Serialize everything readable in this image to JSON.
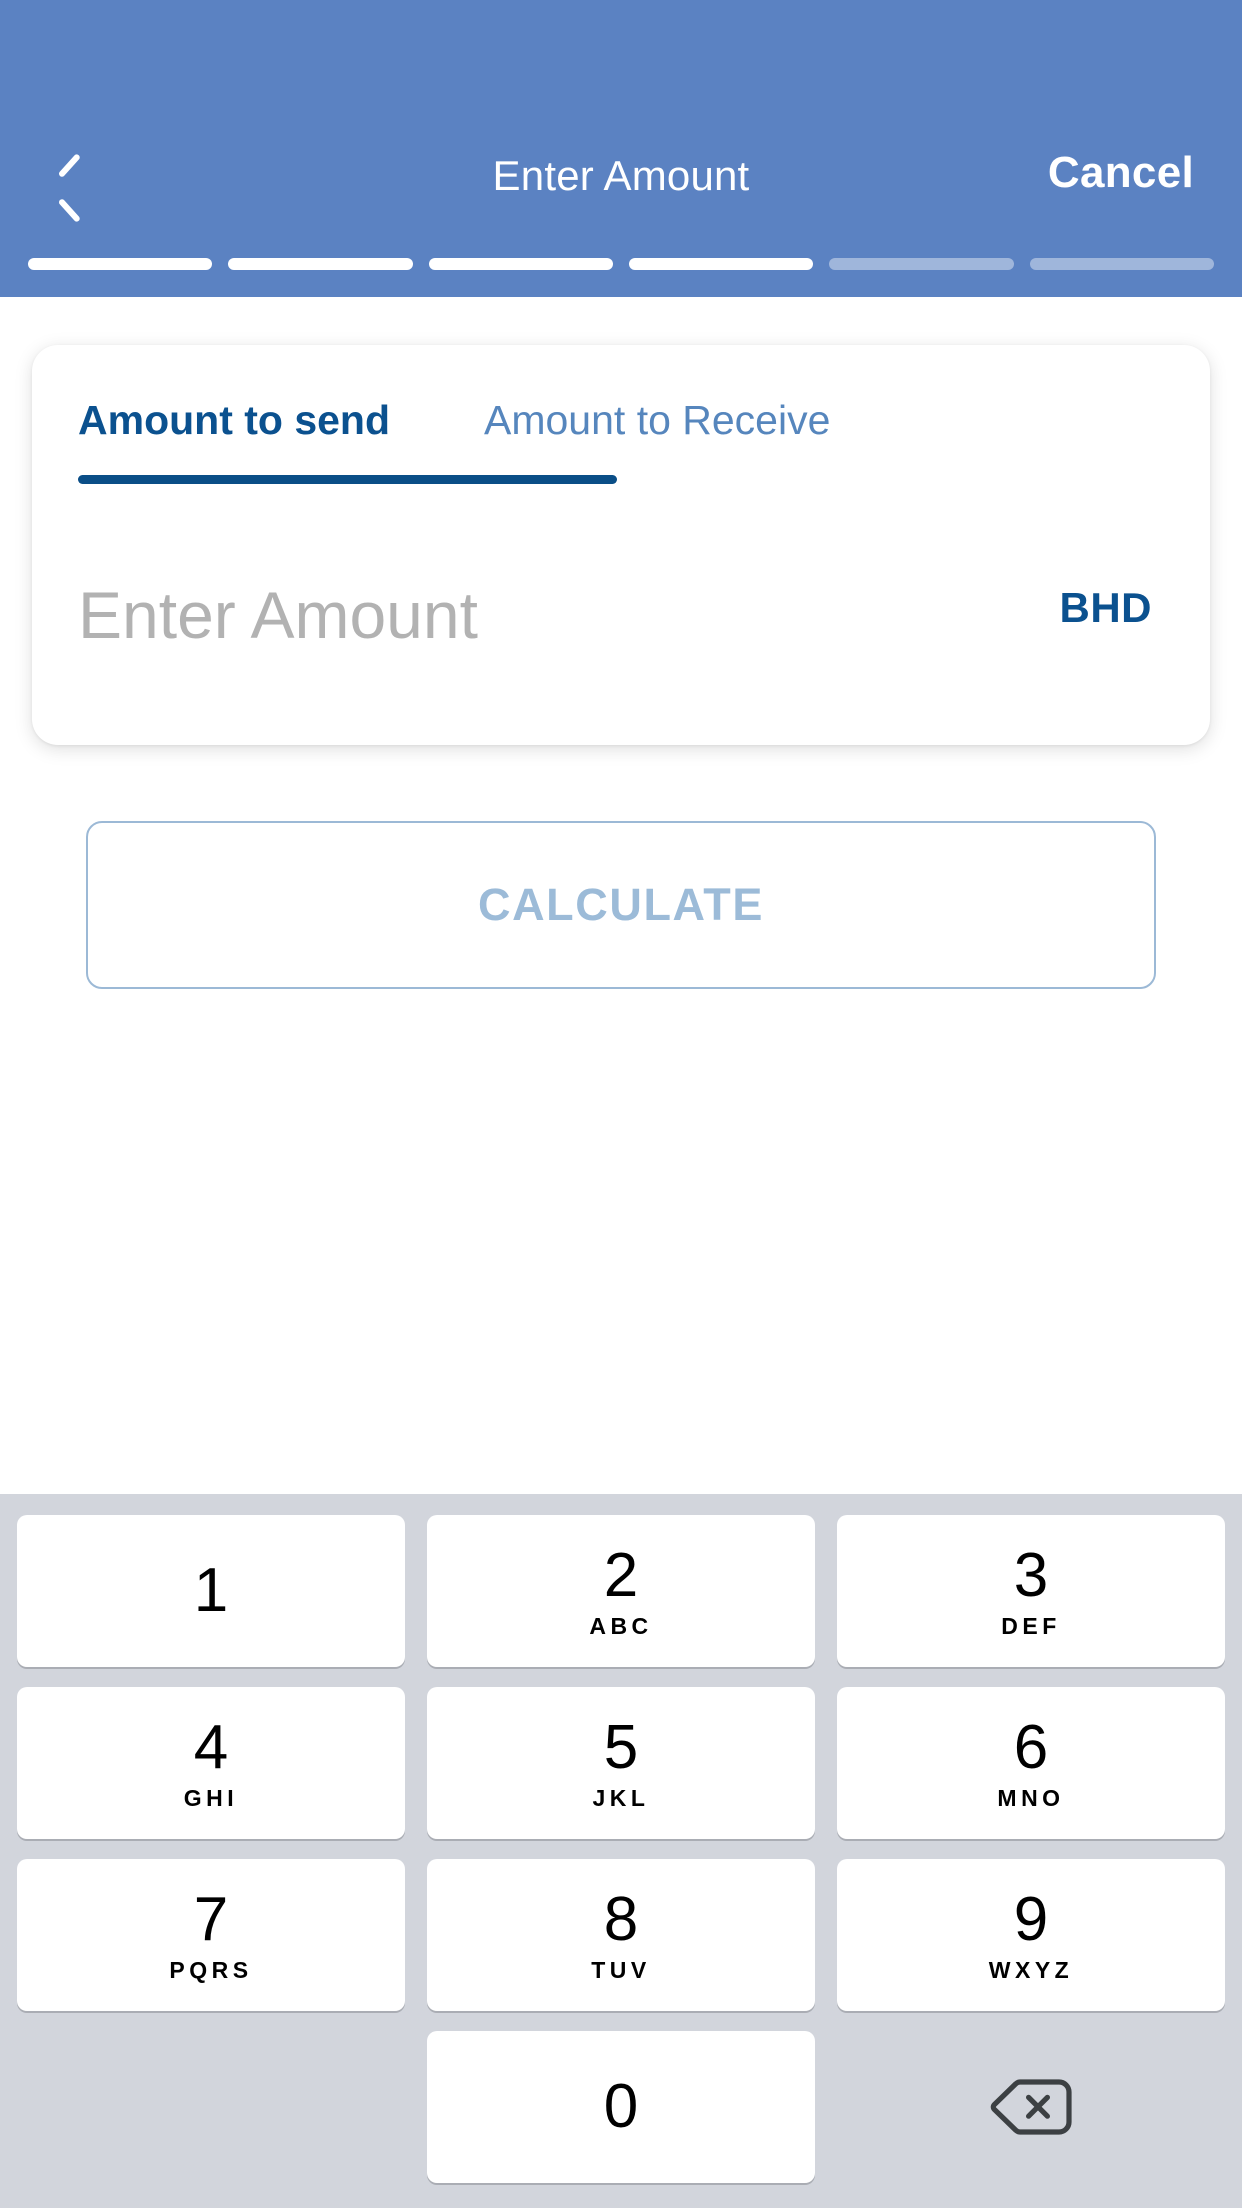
{
  "header": {
    "title": "Enter Amount",
    "back_icon": "chevron-left-icon",
    "cancel_label": "Cancel",
    "progress": {
      "total_steps": 6,
      "completed_steps": 4
    }
  },
  "card": {
    "tabs": [
      {
        "label": "Amount to send",
        "active": true
      },
      {
        "label": "Amount to Receive",
        "active": false
      }
    ],
    "amount_field": {
      "value": "",
      "placeholder": "Enter Amount"
    },
    "currency": "BHD"
  },
  "calculate_button": {
    "label": "CALCULATE",
    "enabled": false
  },
  "keypad": {
    "rows": [
      [
        {
          "digit": "1",
          "letters": ""
        },
        {
          "digit": "2",
          "letters": "ABC"
        },
        {
          "digit": "3",
          "letters": "DEF"
        }
      ],
      [
        {
          "digit": "4",
          "letters": "GHI"
        },
        {
          "digit": "5",
          "letters": "JKL"
        },
        {
          "digit": "6",
          "letters": "MNO"
        }
      ],
      [
        {
          "digit": "7",
          "letters": "PQRS"
        },
        {
          "digit": "8",
          "letters": "TUV"
        },
        {
          "digit": "9",
          "letters": "WXYZ"
        }
      ]
    ],
    "bottom_row": {
      "zero": {
        "digit": "0",
        "letters": ""
      },
      "delete_icon": "backspace-delete-icon"
    }
  },
  "colors": {
    "header_blue": "#5b82c2",
    "brand_dark_blue": "#0b518f",
    "tab_inactive_blue": "#5686bd",
    "calculate_border": "#9cb9d6",
    "calculate_text": "#9cbbd8",
    "placeholder_gray": "#b2b2b2",
    "keypad_background": "#d2d5dc",
    "key_white": "#ffffff",
    "delete_icon_gray": "#3c4043"
  }
}
